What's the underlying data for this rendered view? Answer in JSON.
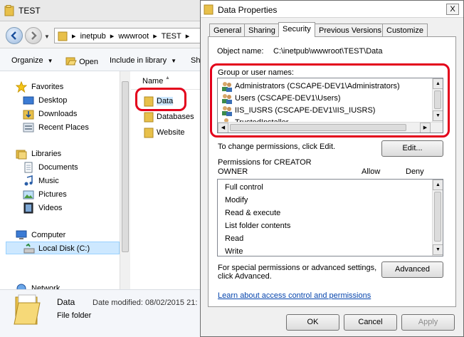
{
  "explorer": {
    "window_title": "TEST",
    "breadcrumbs": [
      "inetpub",
      "wwwroot",
      "TEST"
    ],
    "commands": {
      "organize": "Organize",
      "open": "Open",
      "include": "Include in library",
      "share": "Sh"
    },
    "nav": {
      "favorites": "Favorites",
      "desktop": "Desktop",
      "downloads": "Downloads",
      "recent": "Recent Places",
      "libraries": "Libraries",
      "documents": "Documents",
      "music": "Music",
      "pictures": "Pictures",
      "videos": "Videos",
      "computer": "Computer",
      "local_disk": "Local Disk (C:)",
      "network": "Network"
    },
    "list_header": "Name",
    "items": [
      "Data",
      "Databases",
      "Website"
    ],
    "details": {
      "name": "Data",
      "type": "File folder",
      "date_modified": "Date modified: 08/02/2015 21:"
    }
  },
  "dialog": {
    "title": "Data Properties",
    "close_glyph": "X",
    "tabs": [
      "General",
      "Sharing",
      "Security",
      "Previous Versions",
      "Customize"
    ],
    "object_name_label": "Object name:",
    "object_name_value": "C:\\inetpub\\wwwroot\\TEST\\Data",
    "group_label": "Group or user names:",
    "groups": [
      "Administrators (CSCAPE-DEV1\\Administrators)",
      "Users (CSCAPE-DEV1\\Users)",
      "IIS_IUSRS (CSCAPE-DEV1\\IIS_IUSRS)",
      "TrustedInstaller"
    ],
    "change_text": "To change permissions, click Edit.",
    "edit_button": "Edit...",
    "permissions_for": "Permissions for CREATOR",
    "permissions_for_2": "OWNER",
    "allow_header": "Allow",
    "deny_header": "Deny",
    "permissions": [
      "Full control",
      "Modify",
      "Read & execute",
      "List folder contents",
      "Read",
      "Write"
    ],
    "special_text_1": "For special permissions or advanced settings,",
    "special_text_2": "click Advanced.",
    "advanced_button": "Advanced",
    "learn_link": "Learn about access control and permissions",
    "ok_button": "OK",
    "cancel_button": "Cancel",
    "apply_button": "Apply"
  },
  "colors": {
    "highlight": "#e3001b",
    "selection": "#cde8ff",
    "folder": "#e8c04a",
    "link": "#0645ad"
  }
}
